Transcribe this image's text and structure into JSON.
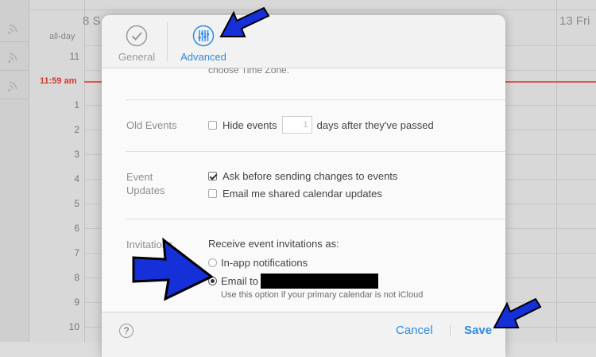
{
  "calendar": {
    "day_left": "8 S",
    "day_right": "13 Fri",
    "all_day_label": "all-day",
    "current_time": "11:59 am",
    "hours": [
      "11",
      "1",
      "2",
      "3",
      "4",
      "5",
      "6",
      "7",
      "8",
      "9",
      "10"
    ]
  },
  "modal": {
    "tabs": [
      {
        "label": "General",
        "icon": "checkmark-circle-icon"
      },
      {
        "label": "Advanced",
        "icon": "sliders-icon"
      }
    ],
    "clipped_text": "choose Time Zone.",
    "old_events": {
      "label": "Old Events",
      "checkbox_label": "Hide events",
      "days_value": "1",
      "suffix": "days after they've passed",
      "checked": false
    },
    "event_updates": {
      "label": "Event Updates",
      "options": [
        {
          "label": "Ask before sending changes to events",
          "checked": true
        },
        {
          "label": "Email me shared calendar updates",
          "checked": false
        }
      ]
    },
    "invitations": {
      "label": "Invitations",
      "prompt": "Receive event invitations as:",
      "option_inapp": "In-app notifications",
      "option_email": "Email to",
      "hint": "Use this option if your primary calendar is not iCloud",
      "selected": "email"
    },
    "footer": {
      "help": "?",
      "cancel": "Cancel",
      "save": "Save"
    }
  },
  "colors": {
    "accent": "#2f8ae0",
    "now_line": "#e25a4f",
    "annotation_arrow": "#1530d8"
  }
}
